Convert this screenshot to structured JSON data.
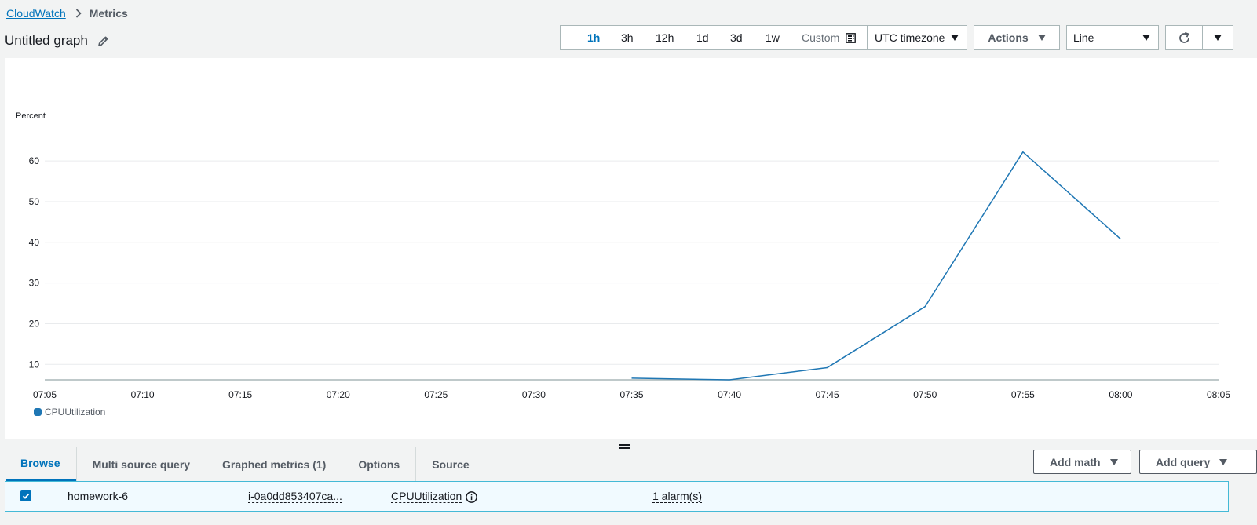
{
  "breadcrumb": {
    "root": "CloudWatch",
    "current": "Metrics"
  },
  "graph": {
    "title": "Untitled graph"
  },
  "toolbar": {
    "ranges": [
      "1h",
      "3h",
      "12h",
      "1d",
      "3d",
      "1w"
    ],
    "active_range": "1h",
    "custom_label": "Custom",
    "timezone": "UTC timezone",
    "actions_label": "Actions",
    "chart_type": "Line"
  },
  "chart_data": {
    "type": "line",
    "ylabel": "Percent",
    "xlabel": "",
    "x": [
      "07:05",
      "07:10",
      "07:15",
      "07:20",
      "07:25",
      "07:30",
      "07:35",
      "07:40",
      "07:45",
      "07:50",
      "07:55",
      "08:00",
      "08:05"
    ],
    "yticks": [
      10,
      20,
      30,
      40,
      50,
      60
    ],
    "ylim": [
      6.2,
      66
    ],
    "grid": true,
    "legend_position": "bottom-left",
    "series": [
      {
        "name": "CPUUtilization",
        "color": "#1f77b4",
        "points": [
          {
            "x": "07:35",
            "y": 6.6
          },
          {
            "x": "07:40",
            "y": 6.2
          },
          {
            "x": "07:45",
            "y": 9.2
          },
          {
            "x": "07:50",
            "y": 24.2
          },
          {
            "x": "07:55",
            "y": 62.2
          },
          {
            "x": "08:00",
            "y": 40.8
          }
        ]
      }
    ]
  },
  "tabs": [
    "Browse",
    "Multi source query",
    "Graphed metrics (1)",
    "Options",
    "Source"
  ],
  "active_tab": "Browse",
  "bottom_actions": {
    "add_math": "Add math",
    "add_query": "Add query"
  },
  "metric_row": {
    "checked": true,
    "label": "homework-6",
    "instance": "i-0a0dd853407ca...",
    "metric": "CPUUtilization",
    "alarms": "1 alarm(s)"
  }
}
